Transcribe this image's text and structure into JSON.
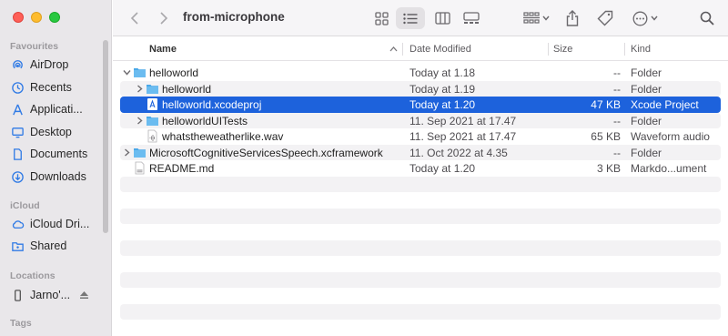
{
  "window": {
    "title": "from-microphone"
  },
  "sidebar": {
    "favourites_label": "Favourites",
    "favourites": [
      {
        "label": "AirDrop",
        "icon": "airdrop-icon"
      },
      {
        "label": "Recents",
        "icon": "clock-icon"
      },
      {
        "label": "Applicati...",
        "icon": "applications-icon"
      },
      {
        "label": "Desktop",
        "icon": "desktop-icon"
      },
      {
        "label": "Documents",
        "icon": "document-icon"
      },
      {
        "label": "Downloads",
        "icon": "download-icon"
      }
    ],
    "icloud_label": "iCloud",
    "icloud": [
      {
        "label": "iCloud Dri...",
        "icon": "cloud-icon"
      },
      {
        "label": "Shared",
        "icon": "shared-folder-icon"
      }
    ],
    "locations_label": "Locations",
    "locations": [
      {
        "label": "Jarno'...",
        "icon": "phone-icon"
      }
    ],
    "tags_label": "Tags"
  },
  "columns": {
    "name": "Name",
    "date": "Date Modified",
    "size": "Size",
    "kind": "Kind"
  },
  "rows": [
    {
      "name": "helloworld",
      "date": "Today at 1.18",
      "size": "--",
      "kind": "Folder"
    },
    {
      "name": "helloworld",
      "date": "Today at 1.19",
      "size": "--",
      "kind": "Folder"
    },
    {
      "name": "helloworld.xcodeproj",
      "date": "Today at 1.20",
      "size": "47 KB",
      "kind": "Xcode Project"
    },
    {
      "name": "helloworldUITests",
      "date": "11. Sep 2021 at 17.47",
      "size": "--",
      "kind": "Folder"
    },
    {
      "name": "whatstheweatherlike.wav",
      "date": "11. Sep 2021 at 17.47",
      "size": "65 KB",
      "kind": "Waveform audio"
    },
    {
      "name": "MicrosoftCognitiveServicesSpeech.xcframework",
      "date": "11. Oct 2022 at 4.35",
      "size": "--",
      "kind": "Folder"
    },
    {
      "name": "README.md",
      "date": "Today at 1.20",
      "size": "3 KB",
      "kind": "Markdo...ument"
    }
  ],
  "colors": {
    "selection": "#1d62dc",
    "folder": "#4aa8e8"
  }
}
